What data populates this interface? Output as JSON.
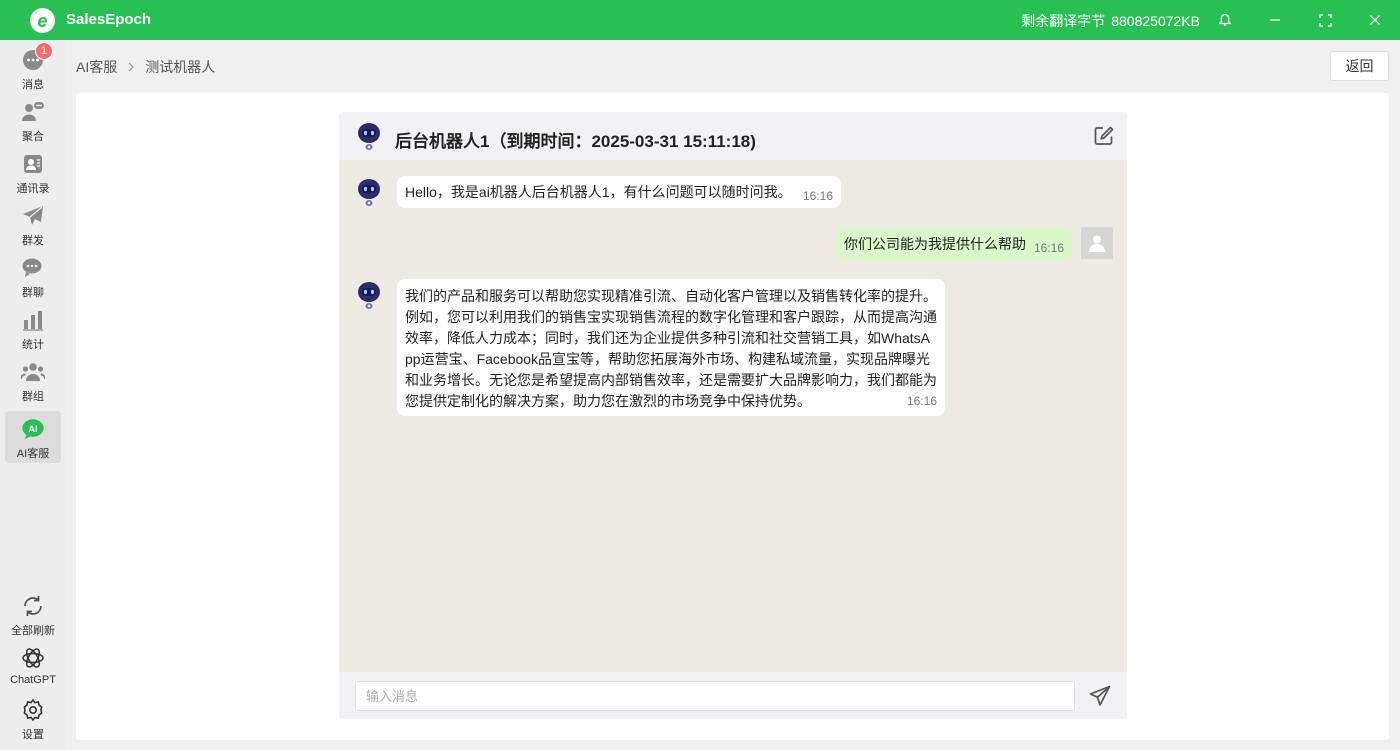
{
  "app": {
    "name": "SalesEpoch",
    "logo_letter": "e"
  },
  "titlebar": {
    "quota_label": "剩余翻译字节",
    "quota_value": "880825072KB",
    "icons": [
      "bell-icon",
      "minimize-icon",
      "maximize-icon",
      "close-icon"
    ]
  },
  "sidebar": {
    "items": [
      {
        "label": "消息",
        "icon": "message-icon",
        "badge": "1"
      },
      {
        "label": "聚合",
        "icon": "aggregate-icon"
      },
      {
        "label": "通讯录",
        "icon": "contacts-icon"
      },
      {
        "label": "群发",
        "icon": "send-broadcast-icon"
      },
      {
        "label": "群聊",
        "icon": "group-chat-icon"
      },
      {
        "label": "统计",
        "icon": "stats-icon"
      },
      {
        "label": "群组",
        "icon": "groups-icon"
      },
      {
        "label": "AI客服",
        "icon": "ai-icon",
        "active": true
      }
    ],
    "bottom_items": [
      {
        "label": "全部刷新",
        "icon": "refresh-icon"
      },
      {
        "label": "ChatGPT",
        "icon": "chatgpt-icon"
      },
      {
        "label": "设置",
        "icon": "settings-icon"
      }
    ]
  },
  "breadcrumb": {
    "parent": "AI客服",
    "current": "测试机器人"
  },
  "back_button": "返回",
  "chat": {
    "title": "后台机器人1（到期时间：2025-03-31 15:11:18)",
    "messages": [
      {
        "from": "bot",
        "text": "Hello，我是ai机器人后台机器人1，有什么问题可以随时问我。",
        "time": "16:16"
      },
      {
        "from": "me",
        "text": "你们公司能为我提供什么帮助",
        "time": "16:16"
      },
      {
        "from": "bot",
        "lines": [
          "我们的产品和服务可以帮助您实现精准引流、自动化客户管理以及销售转化率的提升。",
          "例如，您可以利用我们的销售宝实现销售流程的数字化管理和客户跟踪，从而提高沟通",
          "效率，降低人力成本；同时，我们还为企业提供多种引流和社交营销工具，如WhatsA",
          "pp运营宝、Facebook品宣宝等，帮助您拓展海外市场、构建私域流量，实现品牌曝光",
          "和业务增长。无论您是希望提高内部销售效率，还是需要扩大品牌影响力，我们都能为",
          "您提供定制化的解决方案，助力您在激烈的市场竞争中保持优势。"
        ],
        "time": "16:16"
      }
    ],
    "input_placeholder": "输入消息",
    "accent": "#28c052",
    "bot_color": "#2d2a6e"
  }
}
